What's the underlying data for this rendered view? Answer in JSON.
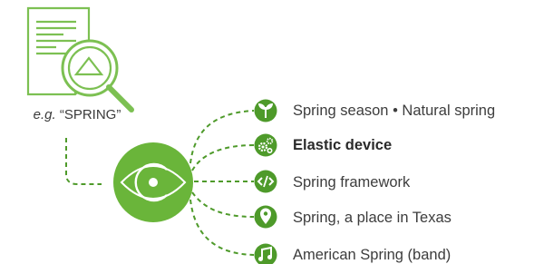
{
  "example": {
    "prefix": "e.g.",
    "term": "“SPRING”"
  },
  "meanings": [
    {
      "label": "Spring season • Natural spring",
      "icon": "sprout-icon",
      "emphasis": false
    },
    {
      "label": "Elastic device",
      "icon": "gears-icon",
      "emphasis": true
    },
    {
      "label": "Spring framework",
      "icon": "code-icon",
      "emphasis": false
    },
    {
      "label": "Spring, a place in Texas",
      "icon": "map-pin-icon",
      "emphasis": false
    },
    {
      "label": "American Spring (band)",
      "icon": "music-note-icon",
      "emphasis": false
    }
  ],
  "colors": {
    "accent": "#6ab53a",
    "accent_dark": "#4e9a2a",
    "document": "#7cc052",
    "text": "#3d3d3d"
  }
}
